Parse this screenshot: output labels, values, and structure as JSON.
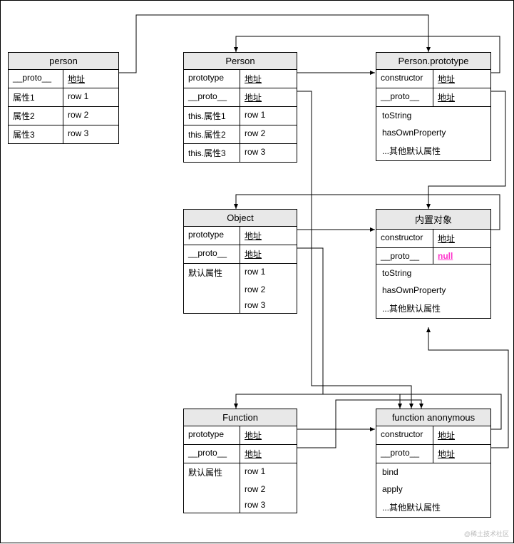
{
  "labels": {
    "proto": "__proto__",
    "addr": "地址",
    "prototype": "prototype",
    "constructor": "constructor",
    "defaultAttr": "默认属性",
    "row1": "row 1",
    "row2": "row 2",
    "row3": "row 3",
    "toString": "toString",
    "hasOwnProperty": "hasOwnProperty",
    "otherDefault": "...其他默认属性",
    "bind": "bind",
    "apply": "apply",
    "null": "null"
  },
  "boxes": {
    "person": {
      "title": "person",
      "attr1": "属性1",
      "attr2": "属性2",
      "attr3": "属性3"
    },
    "Person": {
      "title": "Person",
      "thisAttr1": "this.属性1",
      "thisAttr2": "this.属性2",
      "thisAttr3": "this.属性3"
    },
    "PersonPrototype": {
      "title": "Person.prototype"
    },
    "Object": {
      "title": "Object"
    },
    "innerObj": {
      "title": "内置对象"
    },
    "Function": {
      "title": "Function"
    },
    "funcAnon": {
      "title": "function anonymous"
    }
  },
  "watermark": "@稀土技术社区",
  "chart_data": {
    "type": "diagram",
    "title": "JavaScript prototype chain diagram",
    "nodes": [
      {
        "id": "person",
        "label": "person",
        "rows": [
          [
            "__proto__",
            "地址"
          ],
          [
            "属性1",
            "row 1"
          ],
          [
            "属性2",
            "row 2"
          ],
          [
            "属性3",
            "row 3"
          ]
        ]
      },
      {
        "id": "Person",
        "label": "Person",
        "rows": [
          [
            "prototype",
            "地址"
          ],
          [
            "__proto__",
            "地址"
          ],
          [
            "this.属性1",
            "row 1"
          ],
          [
            "this.属性2",
            "row 2"
          ],
          [
            "this.属性3",
            "row 3"
          ]
        ]
      },
      {
        "id": "PersonPrototype",
        "label": "Person.prototype",
        "rows": [
          [
            "constructor",
            "地址"
          ],
          [
            "__proto__",
            "地址"
          ],
          [
            "toString",
            ""
          ],
          [
            "hasOwnProperty",
            ""
          ],
          [
            "...其他默认属性",
            ""
          ]
        ]
      },
      {
        "id": "Object",
        "label": "Object",
        "rows": [
          [
            "prototype",
            "地址"
          ],
          [
            "__proto__",
            "地址"
          ],
          [
            "默认属性",
            "row 1"
          ],
          [
            "",
            "row 2"
          ],
          [
            "",
            "row 3"
          ]
        ]
      },
      {
        "id": "innerObj",
        "label": "内置对象",
        "rows": [
          [
            "constructor",
            "地址"
          ],
          [
            "__proto__",
            "null"
          ],
          [
            "toString",
            ""
          ],
          [
            "hasOwnProperty",
            ""
          ],
          [
            "...其他默认属性",
            ""
          ]
        ]
      },
      {
        "id": "Function",
        "label": "Function",
        "rows": [
          [
            "prototype",
            "地址"
          ],
          [
            "__proto__",
            "地址"
          ],
          [
            "默认属性",
            "row 1"
          ],
          [
            "",
            "row 2"
          ],
          [
            "",
            "row 3"
          ]
        ]
      },
      {
        "id": "funcAnon",
        "label": "function anonymous",
        "rows": [
          [
            "constructor",
            "地址"
          ],
          [
            "__proto__",
            "地址"
          ],
          [
            "bind",
            ""
          ],
          [
            "apply",
            ""
          ],
          [
            "...其他默认属性",
            ""
          ]
        ]
      }
    ],
    "edges": [
      {
        "from": "person.__proto__",
        "to": "PersonPrototype"
      },
      {
        "from": "Person.prototype",
        "to": "PersonPrototype"
      },
      {
        "from": "Person.__proto__",
        "to": "funcAnon"
      },
      {
        "from": "PersonPrototype.constructor",
        "to": "Person"
      },
      {
        "from": "PersonPrototype.__proto__",
        "to": "innerObj"
      },
      {
        "from": "Object.prototype",
        "to": "innerObj"
      },
      {
        "from": "Object.__proto__",
        "to": "funcAnon"
      },
      {
        "from": "innerObj.constructor",
        "to": "Object"
      },
      {
        "from": "Function.prototype",
        "to": "funcAnon"
      },
      {
        "from": "Function.__proto__",
        "to": "funcAnon"
      },
      {
        "from": "funcAnon.constructor",
        "to": "Function"
      },
      {
        "from": "funcAnon.__proto__",
        "to": "innerObj"
      }
    ]
  }
}
